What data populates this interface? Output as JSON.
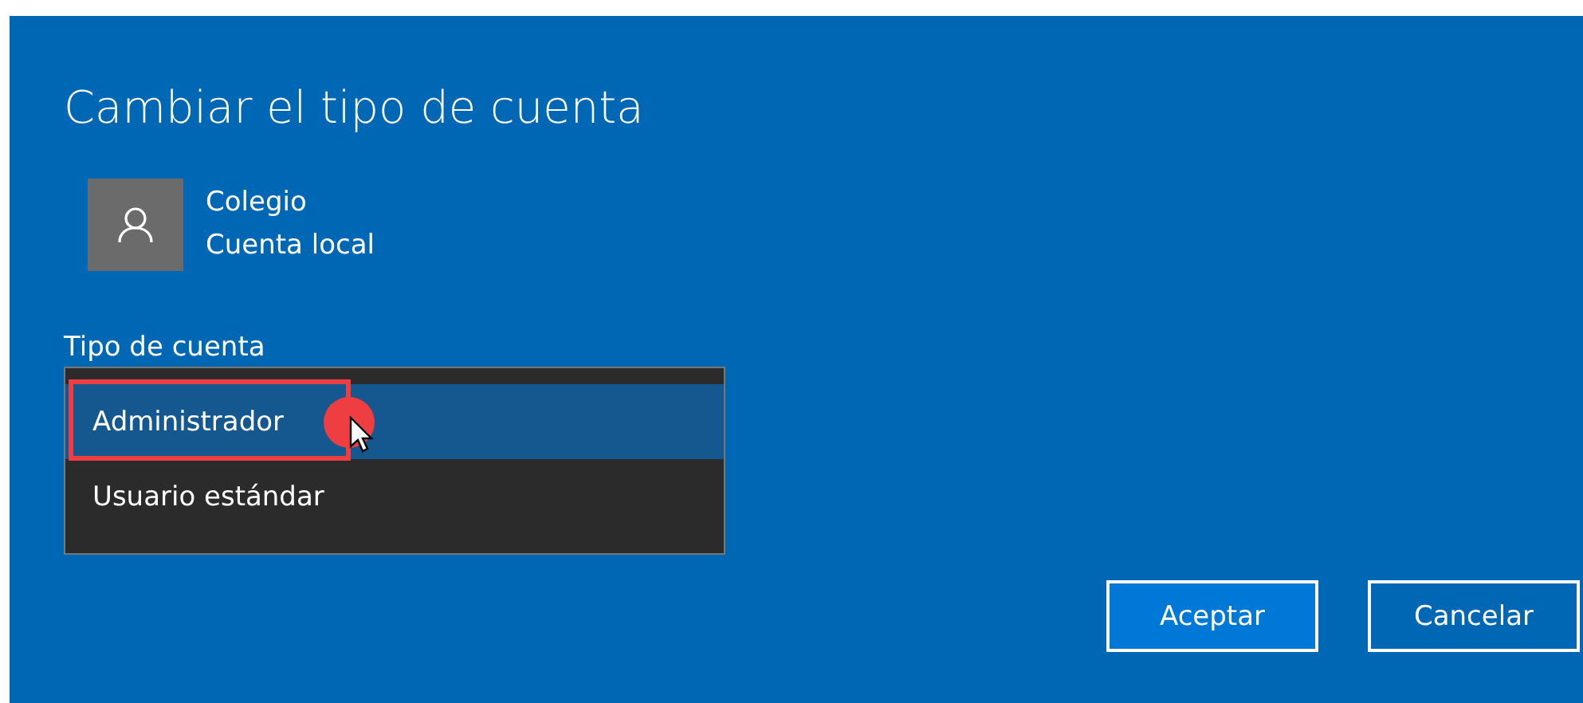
{
  "dialog": {
    "title": "Cambiar el tipo de cuenta"
  },
  "account": {
    "name": "Colegio",
    "type": "Cuenta local"
  },
  "account_type": {
    "label": "Tipo de cuenta",
    "options": [
      {
        "label": "Administrador",
        "selected": true,
        "highlighted": true
      },
      {
        "label": "Usuario estándar",
        "selected": false,
        "highlighted": false
      }
    ]
  },
  "buttons": [
    {
      "label": "Aceptar",
      "kind": "primary"
    },
    {
      "label": "Cancelar",
      "kind": "secondary"
    }
  ]
}
